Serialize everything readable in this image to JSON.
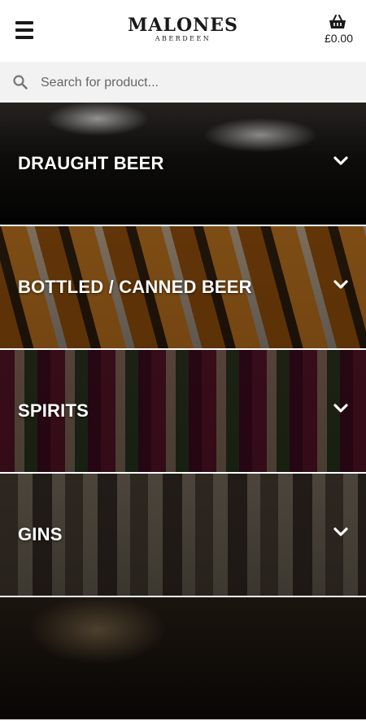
{
  "header": {
    "logo_main": "MALONES",
    "logo_sub": "ABERDEEN",
    "cart_total": "£0.00"
  },
  "search": {
    "placeholder": "Search for product..."
  },
  "categories": [
    {
      "label": "DRAUGHT BEER"
    },
    {
      "label": "BOTTLED / CANNED BEER"
    },
    {
      "label": "SPIRITS"
    },
    {
      "label": "GINS"
    },
    {
      "label": ""
    }
  ],
  "icons": {
    "menu": "hamburger-icon",
    "cart": "basket-icon",
    "search": "search-icon",
    "expand": "chevron-down-icon"
  }
}
